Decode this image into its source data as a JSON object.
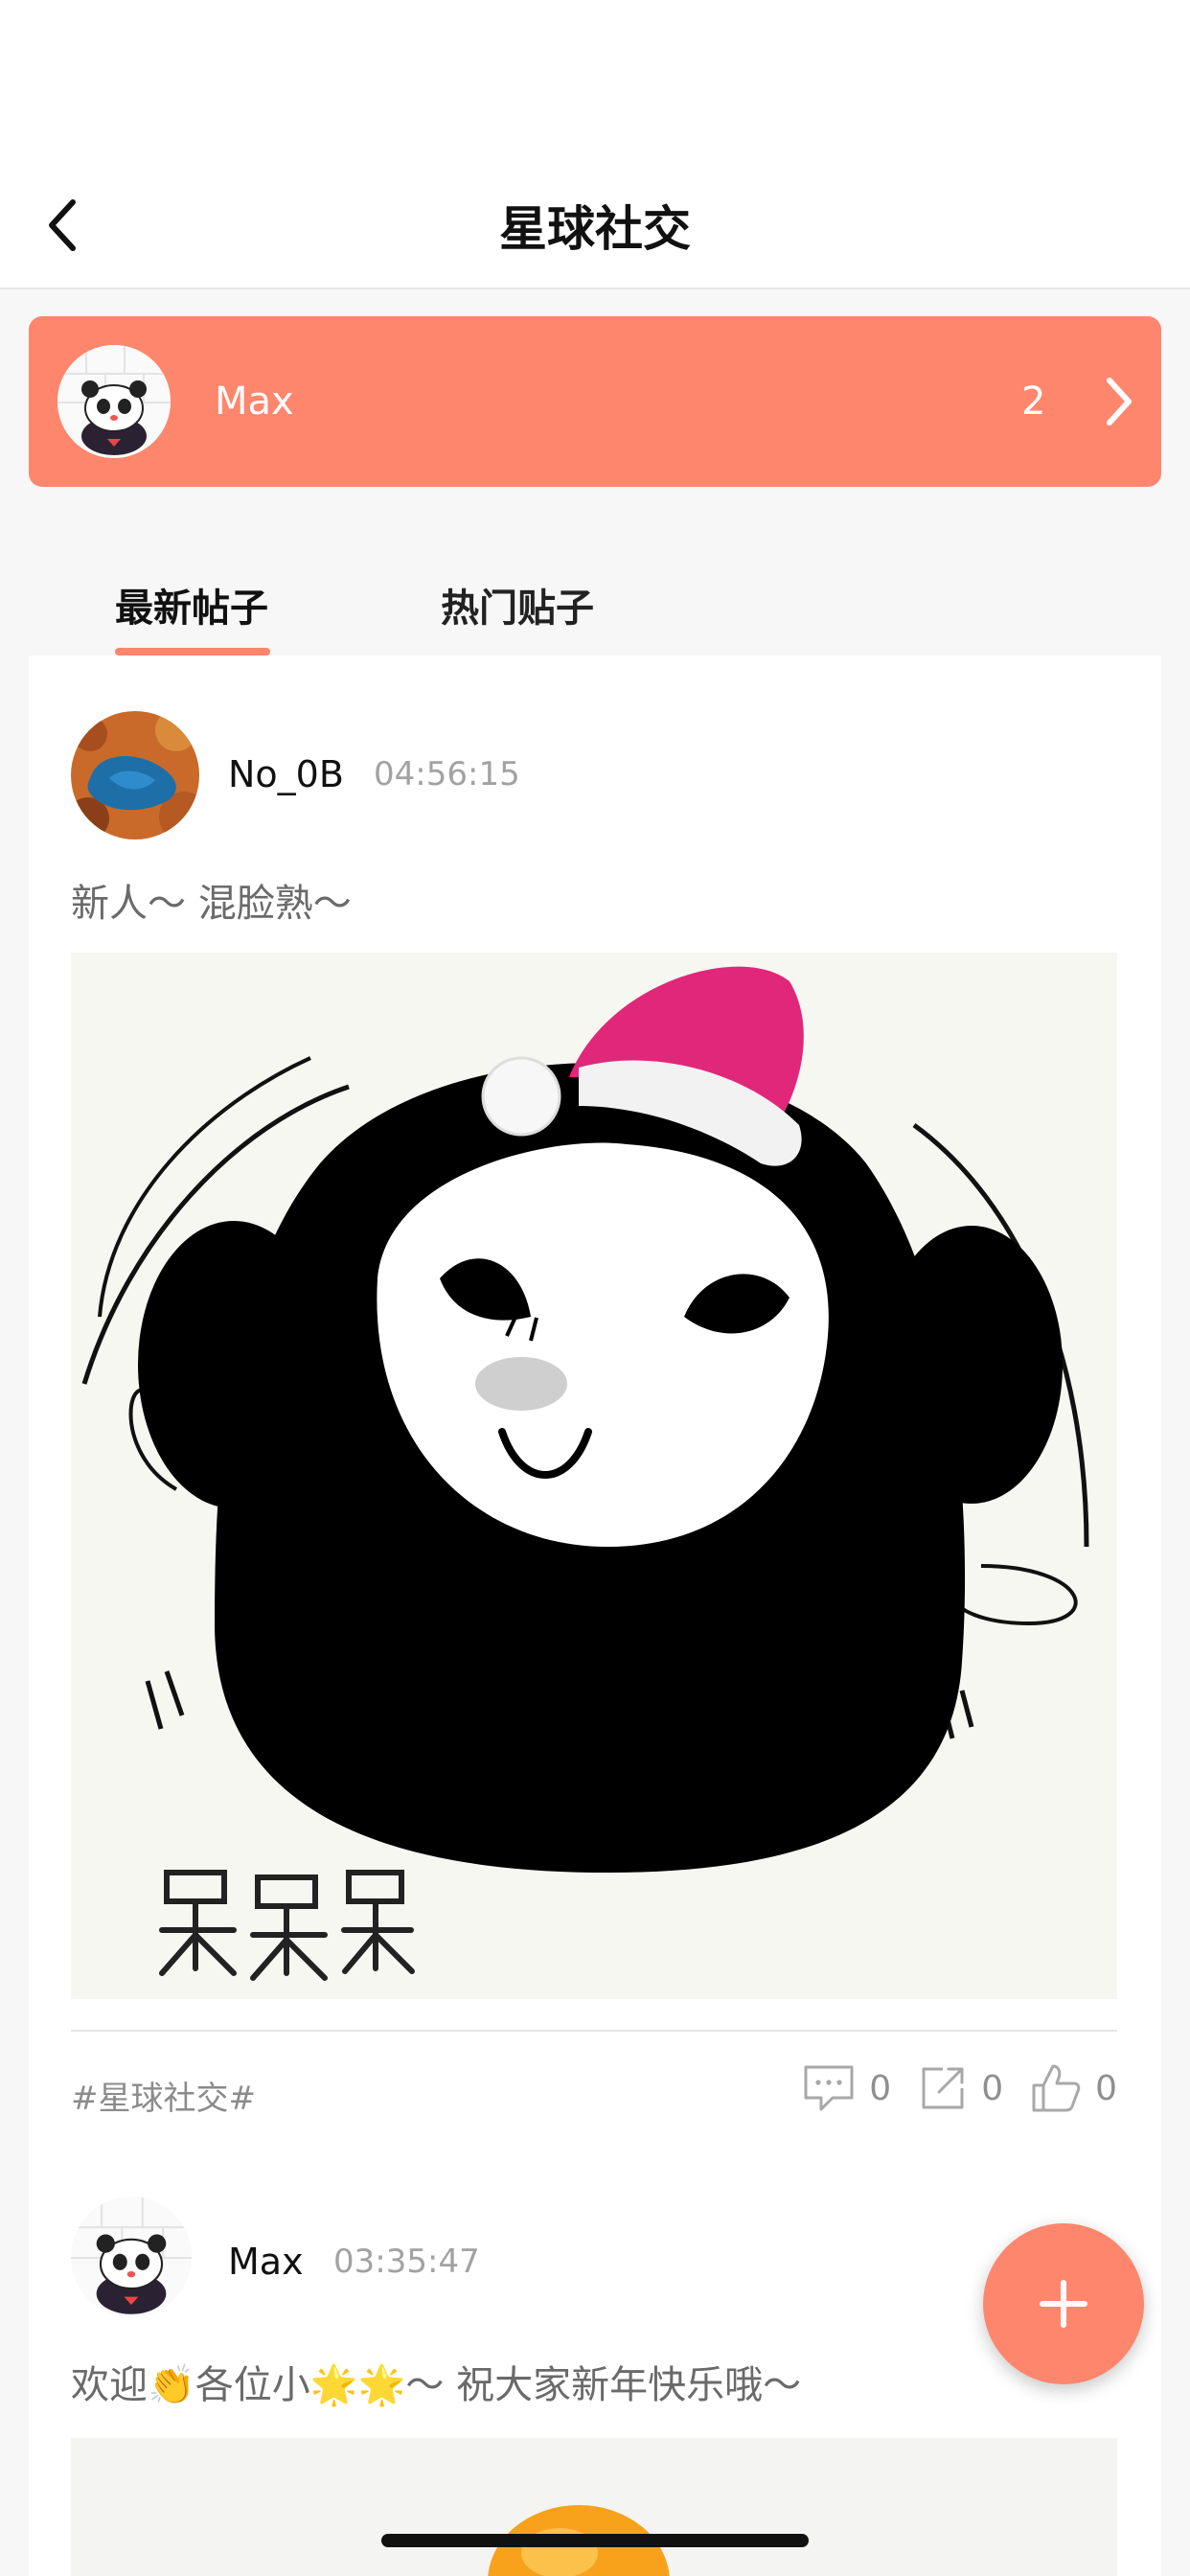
{
  "header": {
    "title": "星球社交",
    "back_icon": "back-arrow-icon"
  },
  "user_banner": {
    "name": "Max",
    "count": "2",
    "background_color": "#fe866d",
    "chevron_icon": "chevron-right-icon"
  },
  "tabs": [
    {
      "label": "最新帖子",
      "active": true
    },
    {
      "label": "热门贴子",
      "active": false
    }
  ],
  "posts": [
    {
      "username": "No_0B",
      "time": "04:56:15",
      "text": "新人～ 混脸熟～",
      "image_caption": "呆呆呆",
      "tag": "#星球社交#",
      "comments": "0",
      "shares": "0",
      "likes": "0"
    },
    {
      "username": "Max",
      "time": "03:35:47",
      "text": "欢迎👏各位小🌟🌟～ 祝大家新年快乐哦～"
    }
  ],
  "icons": {
    "comment": "comment-icon",
    "share": "share-icon",
    "like": "thumbs-up-icon",
    "fab": "plus-icon"
  },
  "colors": {
    "accent": "#fe866d",
    "muted_text": "#8f8f8f"
  }
}
